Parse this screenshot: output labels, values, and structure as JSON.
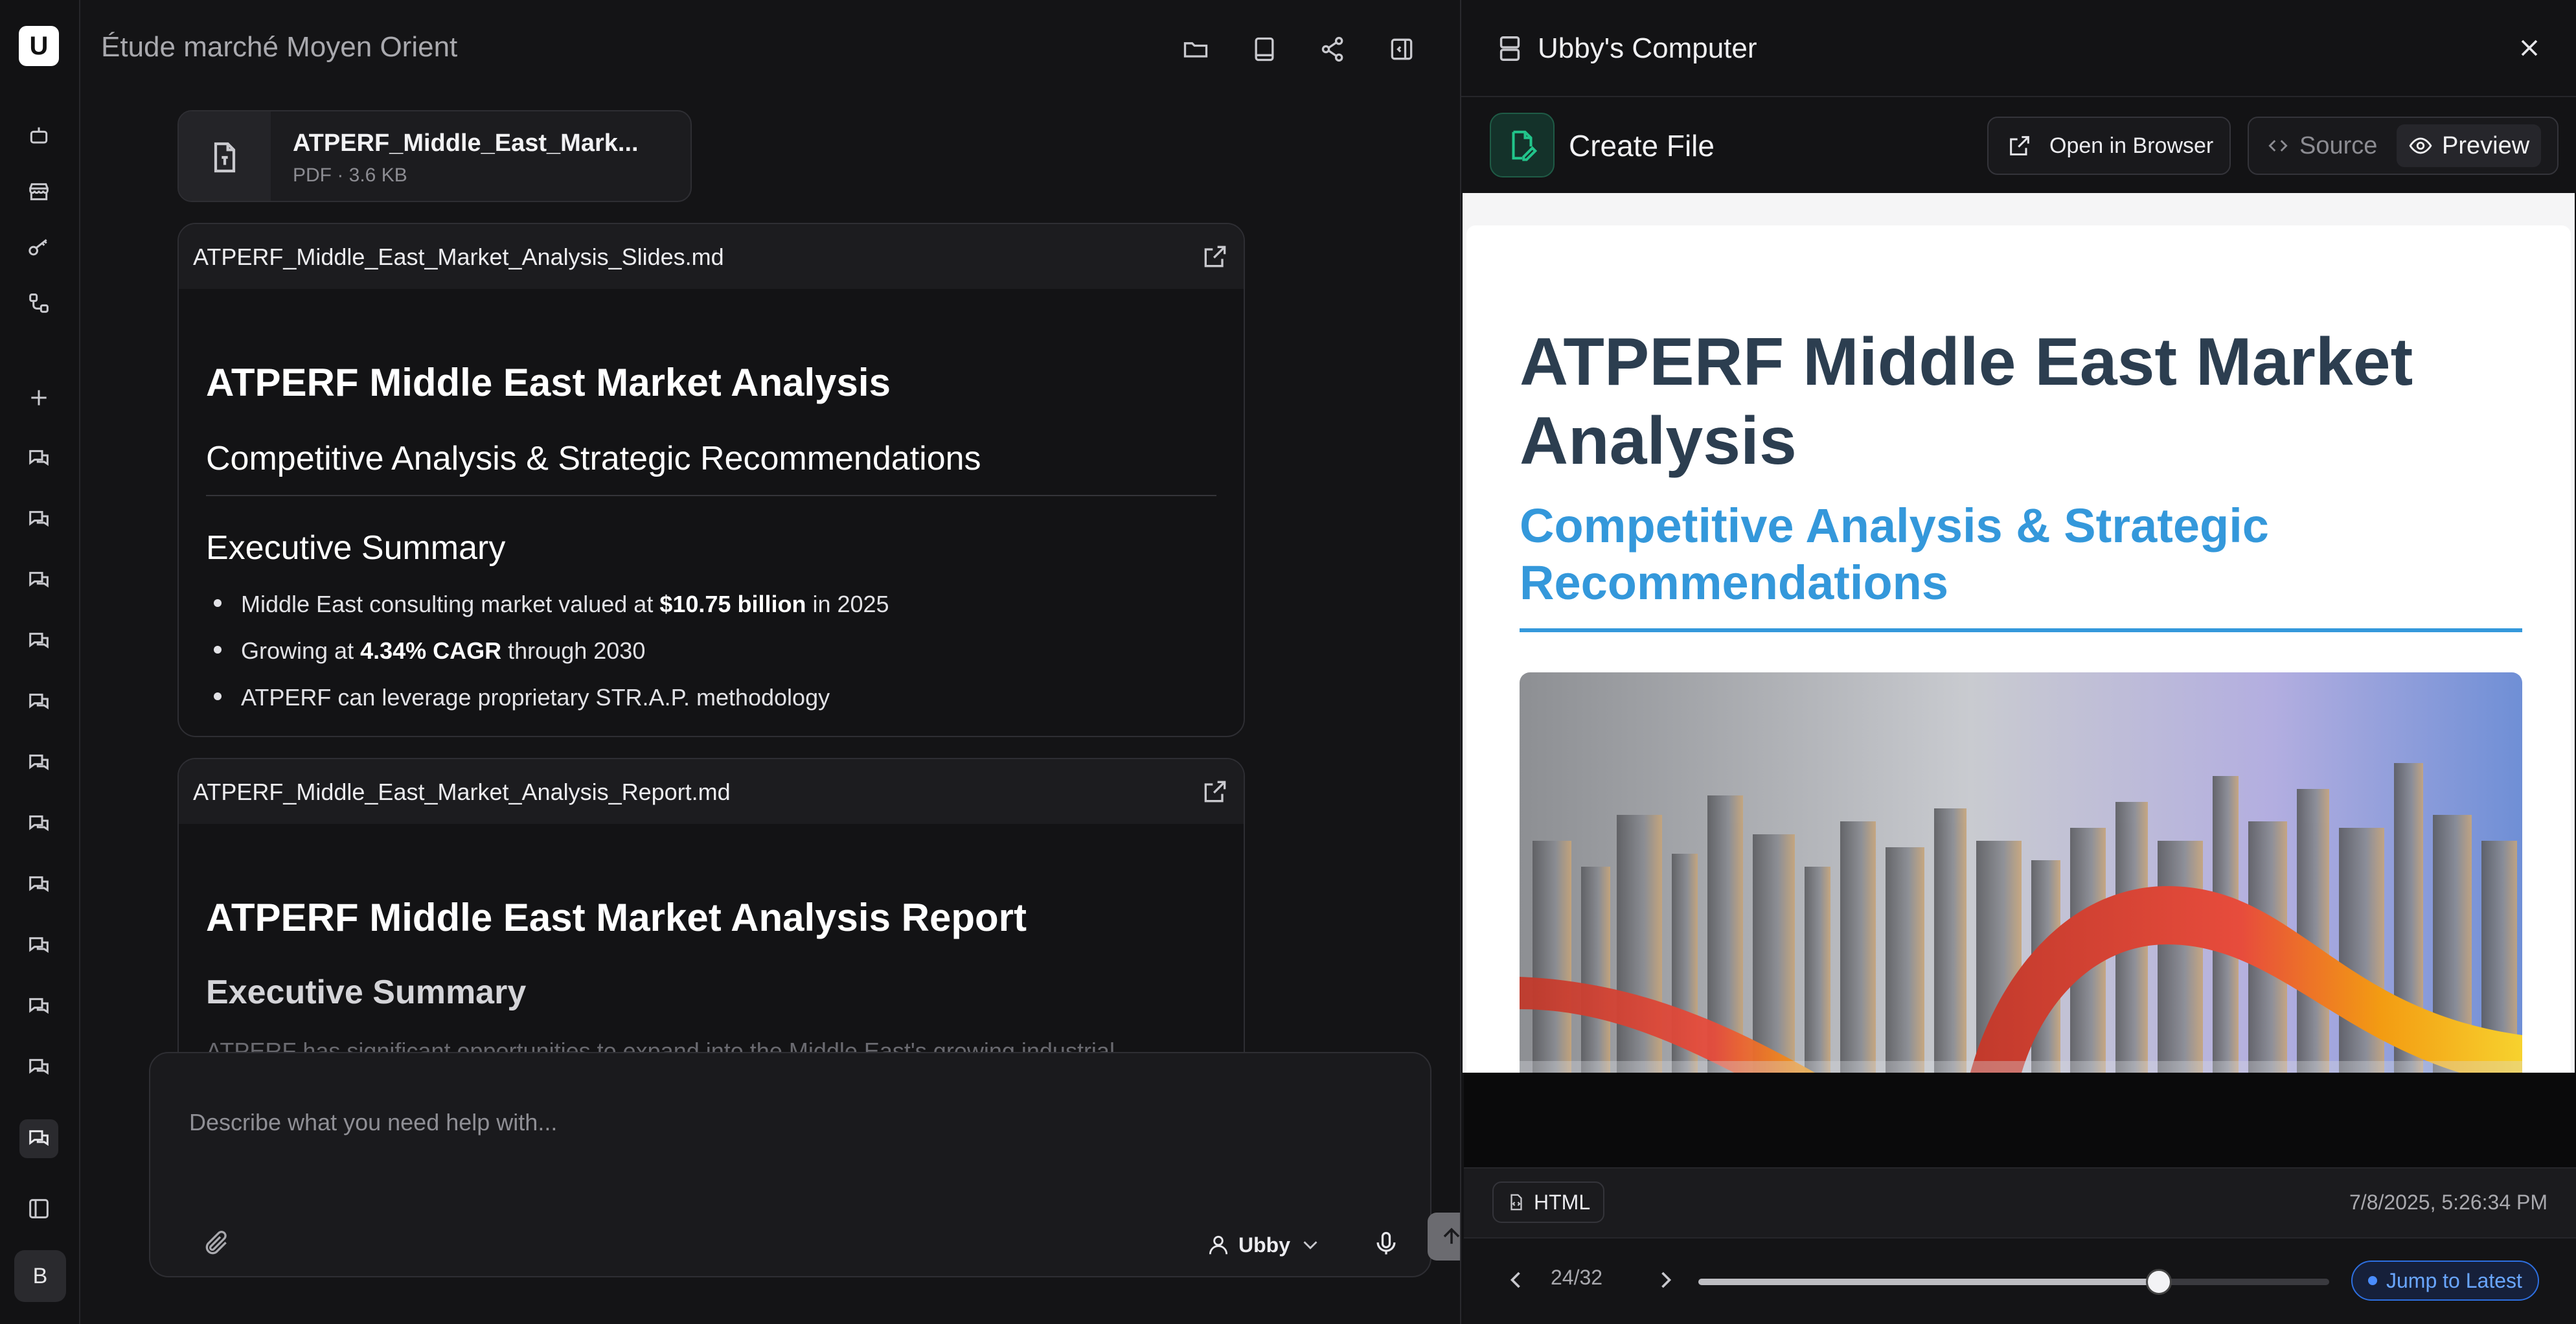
{
  "conversation": {
    "title": "Étude marché Moyen Orient"
  },
  "topbar_icons": [
    "folder-icon",
    "book-icon",
    "share-icon",
    "panel-toggle-icon"
  ],
  "attachment": {
    "name": "ATPERF_Middle_East_Mark...",
    "meta": "PDF · 3.6 KB",
    "icon": "pdf-file-icon"
  },
  "slides_card": {
    "filename": "ATPERF_Middle_East_Market_Analysis_Slides.md",
    "h1": "ATPERF Middle East Market Analysis",
    "h2": "Competitive Analysis & Strategic Recommendations",
    "h3": "Executive Summary",
    "bullets": [
      {
        "pre": "Middle East consulting market valued at ",
        "bold": "$10.75 billion",
        "post": " in 2025"
      },
      {
        "pre": "Growing at ",
        "bold": "4.34% CAGR",
        "post": " through 2030"
      },
      {
        "pre": "ATPERF can leverage proprietary STR.A.P. methodology",
        "bold": "",
        "post": ""
      }
    ]
  },
  "report_card": {
    "filename": "ATPERF_Middle_East_Market_Analysis_Report.md",
    "h1": "ATPERF Middle East Market Analysis Report",
    "h2": "Executive Summary",
    "fade_text": "ATPERF has significant opportunities to expand into the Middle East's growing industrial"
  },
  "composer": {
    "placeholder": "Describe what you need help with...",
    "agent_label": "Ubby"
  },
  "sidebar": {
    "avatar_letter": "B"
  },
  "panel": {
    "title": "Ubby's Computer",
    "action": "Create File",
    "open_in_browser": "Open in Browser",
    "source_tab": "Source",
    "preview_tab": "Preview",
    "preview_title": "ATPERF Middle East Market Analysis",
    "preview_subtitle": "Competitive Analysis & Strategic Recommendations",
    "file_type": "HTML",
    "timestamp": "7/8/2025, 5:26:34 PM",
    "counter": "24/32",
    "progress": 0.73,
    "jump_label": "Jump to Latest"
  },
  "colors": {
    "accent_blue": "#3498db",
    "heading_dark": "#2c3e50",
    "jump_blue": "#69a6ff",
    "file_green": "#22c58b"
  }
}
